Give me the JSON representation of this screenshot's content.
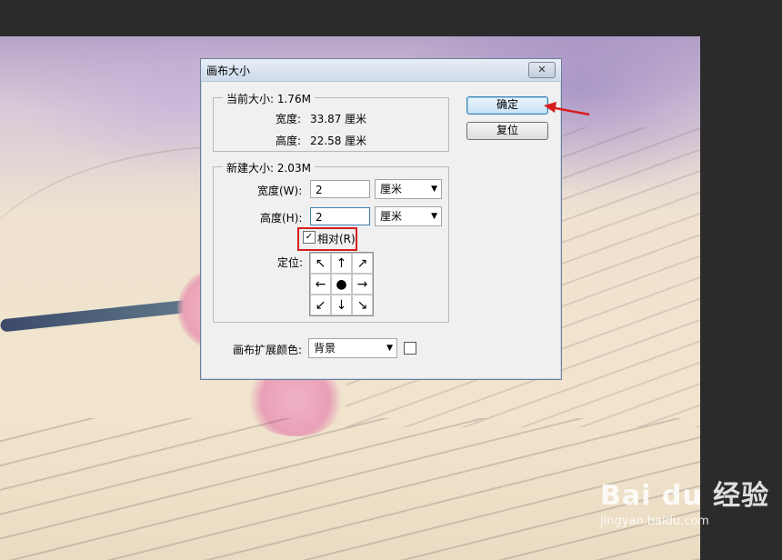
{
  "dialog": {
    "title": "画布大小",
    "close_label": "✕",
    "current_size": {
      "legend": "当前大小: 1.76M",
      "width_label": "宽度:",
      "width_value": "33.87 厘米",
      "height_label": "高度:",
      "height_value": "22.58 厘米"
    },
    "new_size": {
      "legend": "新建大小: 2.03M",
      "width_label": "宽度(W):",
      "width_value": "2",
      "width_unit": "厘米",
      "height_label": "高度(H):",
      "height_value": "2",
      "height_unit": "厘米",
      "relative_label": "相对(R)",
      "relative_checked": true,
      "anchor_label": "定位:",
      "anchor_cells": [
        "↖",
        "↑",
        "↗",
        "←",
        "●",
        "→",
        "↙",
        "↓",
        "↘"
      ]
    },
    "extension_color_label": "画布扩展颜色:",
    "extension_color_value": "背景",
    "buttons": {
      "ok": "确定",
      "reset": "复位"
    }
  },
  "watermark": {
    "logo": "Bai du 经验",
    "url": "jingyan.baidu.com"
  },
  "colors": {
    "highlight": "#d81e1e",
    "dialog_bg": "#f0f0f0"
  }
}
